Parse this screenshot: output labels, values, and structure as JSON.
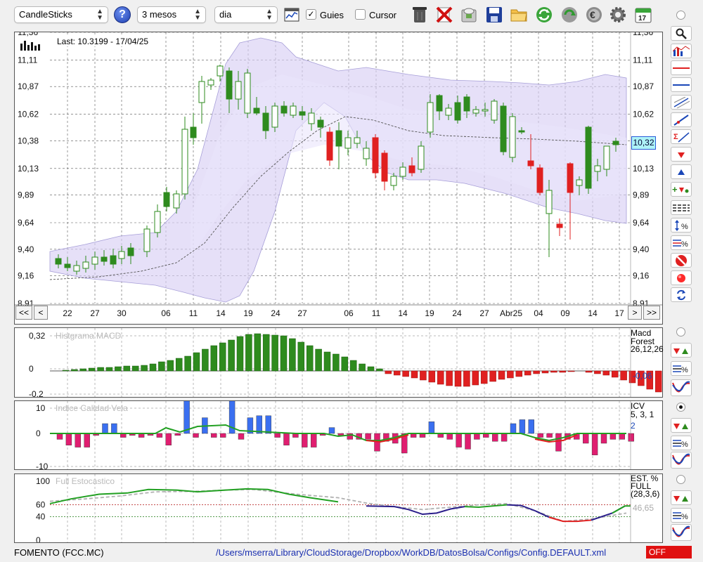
{
  "toolbar": {
    "chart_type": "CandleSticks",
    "period": "3 mesos",
    "interval": "dia",
    "guides_label": "Guies",
    "guides_checked": true,
    "cursor_label": "Cursor",
    "cursor_checked": false,
    "calendar_day": "17"
  },
  "main_chart": {
    "last_label": "Last: 10.3199 - 17/04/25",
    "price_tag": "10,32",
    "y_ticks": [
      "11,36",
      "11,11",
      "10,87",
      "10,62",
      "10,38",
      "10,13",
      "9,89",
      "9,64",
      "9,40",
      "9,16",
      "8,91"
    ],
    "x_ticks": [
      "22",
      "27",
      "30",
      "06",
      "11",
      "14",
      "19",
      "24",
      "27",
      "06",
      "11",
      "14",
      "19",
      "24",
      "27",
      "Abr25",
      "04",
      "09",
      "14",
      "17"
    ],
    "nav": {
      "first": "<<",
      "prev": "<",
      "next": ">",
      "last": ">>"
    }
  },
  "macd": {
    "title": "Histgrama MACD",
    "label1": "Macd",
    "label2": "Forest",
    "params": "26,12,26",
    "value": "-0,06",
    "y_ticks": [
      "0,32",
      "0",
      "-0,2"
    ]
  },
  "icv": {
    "title": "Indice Calidad Vela",
    "label": "ICV",
    "params": "5, 3, 1",
    "value": "2",
    "y_ticks": [
      "10",
      "0",
      "-10"
    ]
  },
  "stoch": {
    "title": "Full Estocastico",
    "label1": "EST. %",
    "label2": "FULL",
    "params": "(28,3,6)",
    "value": "46,65",
    "y_ticks": [
      "100",
      "60",
      "40",
      "0"
    ]
  },
  "status": {
    "ticker": "FOMENTO (FCC.MC)",
    "path": "/Users/mserra/Library/CloudStorage/Dropbox/WorkDB/DatosBolsa/Configs/Config.DEFAULT.xml",
    "mode": "OFF"
  },
  "colors": {
    "up": "#2e8b1e",
    "down": "#e02020",
    "band": "#d8d0f4",
    "accent": "#1a47b8",
    "status_off": "#e01010"
  }
}
